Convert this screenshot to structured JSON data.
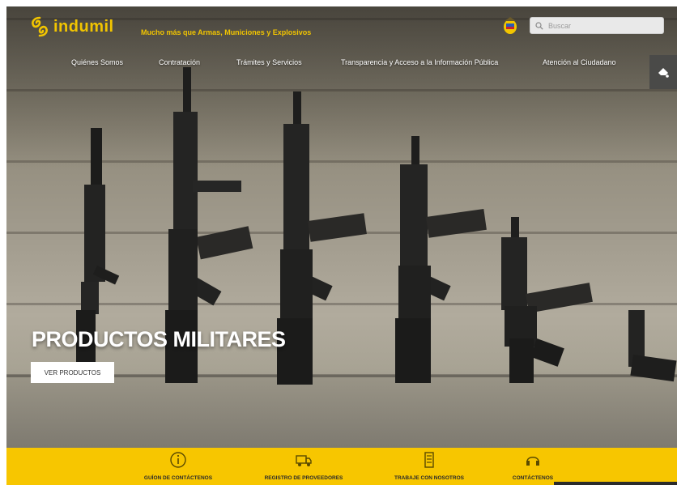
{
  "header": {
    "logo_text": "indumil",
    "slogan": "Mucho más que Armas, Municiones y Explosivos",
    "search": {
      "placeholder": "Buscar"
    }
  },
  "nav": {
    "items": [
      {
        "label": "Quiénes Somos"
      },
      {
        "label": "Contratación"
      },
      {
        "label": "Trámites y Servicios"
      },
      {
        "label": "Transparencia y Acceso a la Información Pública"
      },
      {
        "label": "Atención al Ciudadano"
      }
    ]
  },
  "hero": {
    "title": "PRODUCTOS MILITARES",
    "button_label": "VER PRODUCTOS"
  },
  "bottom_bar": {
    "items": [
      {
        "label": "GUÍON DE CONTÁCTENOS",
        "icon": "info-icon"
      },
      {
        "label": "REGISTRO DE PROVEEDORES",
        "icon": "truck-icon"
      },
      {
        "label": "TRABAJE CON NOSOTROS",
        "icon": "document-icon"
      },
      {
        "label": "CONTÁCTENOS",
        "icon": "headset-icon"
      }
    ]
  },
  "colors": {
    "brand_yellow": "#f7c600",
    "logo_yellow": "#f2c500"
  }
}
